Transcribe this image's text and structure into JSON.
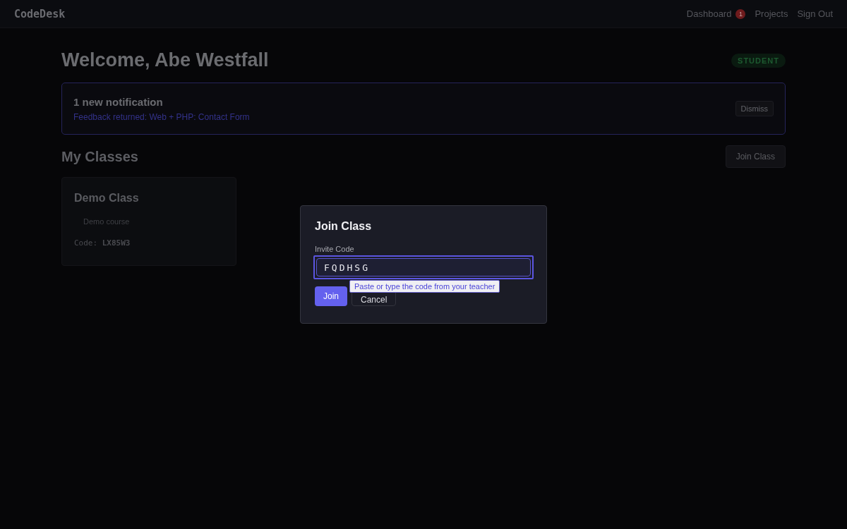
{
  "nav": {
    "brand": "CodeDesk",
    "links": [
      {
        "label": "Dashboard",
        "badge": "1"
      },
      {
        "label": "Projects"
      },
      {
        "label": "Sign Out"
      }
    ]
  },
  "welcome": {
    "title": "Welcome, Abe Westfall",
    "role": "STUDENT"
  },
  "notification": {
    "title": "1 new notification",
    "link": "Feedback returned: Web + PHP: Contact Form",
    "dismiss": "Dismiss"
  },
  "classes": {
    "title": "My Classes",
    "join_button": "Join Class",
    "items": [
      {
        "name": "Demo Class",
        "description": "Demo course",
        "code_label": "Code:",
        "code": "LX85W3"
      }
    ]
  },
  "modal": {
    "title": "Join Class",
    "field_label": "Invite Code",
    "value": "FQDHSG",
    "tooltip": "Paste or type the code from your teacher",
    "buttons": [
      {
        "label": "Join",
        "kind": "primary"
      },
      {
        "label": "Cancel",
        "kind": "secondary"
      }
    ]
  }
}
